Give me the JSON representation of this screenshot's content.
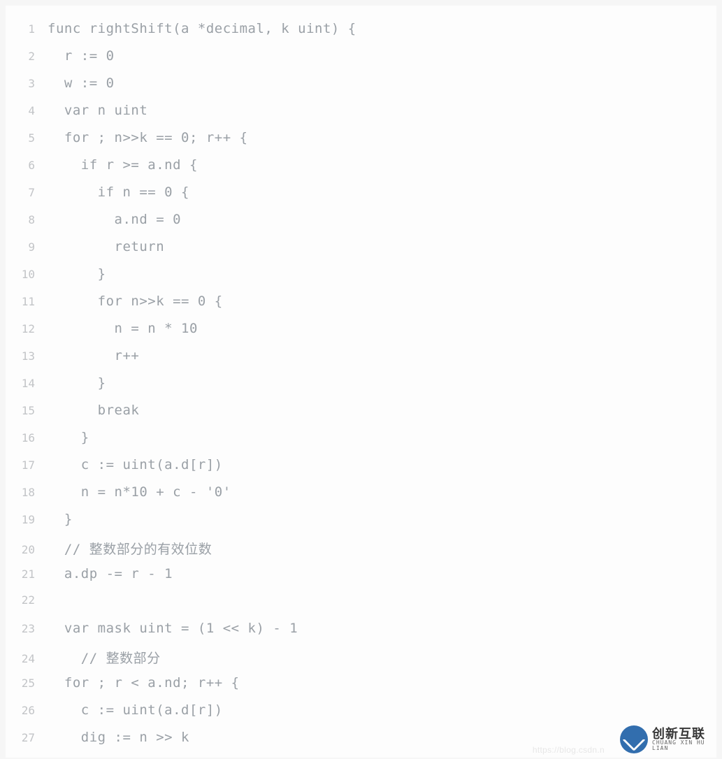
{
  "code": {
    "lines": [
      {
        "n": "1",
        "t": "func rightShift(a *decimal, k uint) {"
      },
      {
        "n": "2",
        "t": "  r := 0"
      },
      {
        "n": "3",
        "t": "  w := 0"
      },
      {
        "n": "4",
        "t": "  var n uint"
      },
      {
        "n": "5",
        "t": "  for ; n>>k == 0; r++ {"
      },
      {
        "n": "6",
        "t": "    if r >= a.nd {"
      },
      {
        "n": "7",
        "t": "      if n == 0 {"
      },
      {
        "n": "8",
        "t": "        a.nd = 0"
      },
      {
        "n": "9",
        "t": "        return"
      },
      {
        "n": "10",
        "t": "      }"
      },
      {
        "n": "11",
        "t": "      for n>>k == 0 {"
      },
      {
        "n": "12",
        "t": "        n = n * 10"
      },
      {
        "n": "13",
        "t": "        r++"
      },
      {
        "n": "14",
        "t": "      }"
      },
      {
        "n": "15",
        "t": "      break"
      },
      {
        "n": "16",
        "t": "    }"
      },
      {
        "n": "17",
        "t": "    c := uint(a.d[r])"
      },
      {
        "n": "18",
        "t": "    n = n*10 + c - '0'"
      },
      {
        "n": "19",
        "t": "  }"
      },
      {
        "n": "20",
        "t": "  // 整数部分的有效位数"
      },
      {
        "n": "21",
        "t": "  a.dp -= r - 1"
      },
      {
        "n": "22",
        "t": ""
      },
      {
        "n": "23",
        "t": "  var mask uint = (1 << k) - 1"
      },
      {
        "n": "24",
        "t": "    // 整数部分"
      },
      {
        "n": "25",
        "t": "  for ; r < a.nd; r++ {"
      },
      {
        "n": "26",
        "t": "    c := uint(a.d[r])"
      },
      {
        "n": "27",
        "t": "    dig := n >> k"
      }
    ]
  },
  "watermark": {
    "url": "https://blog.csdn.n",
    "brand_cn": "创新互联",
    "brand_en": "CHUANG XIN HU LIAN"
  }
}
